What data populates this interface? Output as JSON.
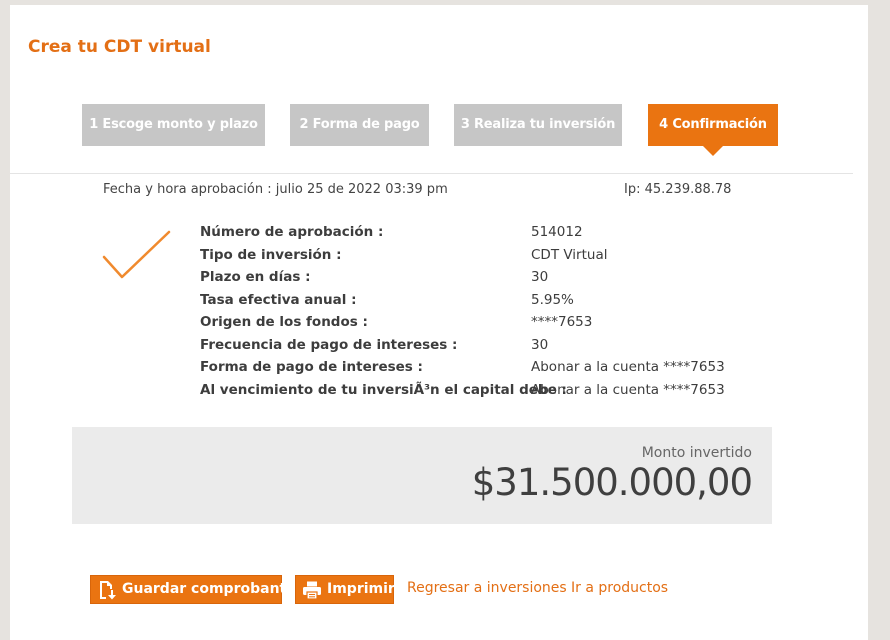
{
  "page": {
    "title": "Crea tu CDT virtual"
  },
  "steps": [
    {
      "label": "1  Escoge monto y plazo",
      "active": false
    },
    {
      "label": "2  Forma de pago",
      "active": false
    },
    {
      "label": "3  Realiza tu inversión",
      "active": false
    },
    {
      "label": "4  Confirmación",
      "active": true
    }
  ],
  "meta": {
    "date_label": "Fecha y hora aprobación :",
    "date_value": "julio 25 de 2022 03:39 pm",
    "ip_label": "Ip:",
    "ip_value": "45.239.88.78"
  },
  "details": [
    {
      "label": "Número de aprobación :",
      "value": "514012"
    },
    {
      "label": "Tipo de inversión :",
      "value": "CDT Virtual"
    },
    {
      "label": "Plazo en días :",
      "value": "30"
    },
    {
      "label": "Tasa efectiva anual :",
      "value": "5.95%"
    },
    {
      "label": "Origen de los fondos :",
      "value": "****7653"
    },
    {
      "label": "Frecuencia de pago de intereses :",
      "value": "30"
    },
    {
      "label": "Forma de pago de intereses :",
      "value": "Abonar a la cuenta ****7653"
    },
    {
      "label": "Al vencimiento de tu inversiÃ³n el capital debe :",
      "value": "Abonar a la cuenta ****7653"
    }
  ],
  "amount": {
    "label": "Monto invertido",
    "value": "$31.500.000,00"
  },
  "actions": {
    "save_label": "Guardar comprobante",
    "print_label": "Imprimir",
    "back_link": "Regresar a inversiones",
    "products_link": "Ir a productos"
  },
  "colors": {
    "accent": "#ea7411",
    "step_inactive": "#c6c6c6",
    "amount_bg": "#ebebeb"
  },
  "icons": {
    "success": "check-icon",
    "save": "download-document-icon",
    "print": "printer-icon"
  }
}
